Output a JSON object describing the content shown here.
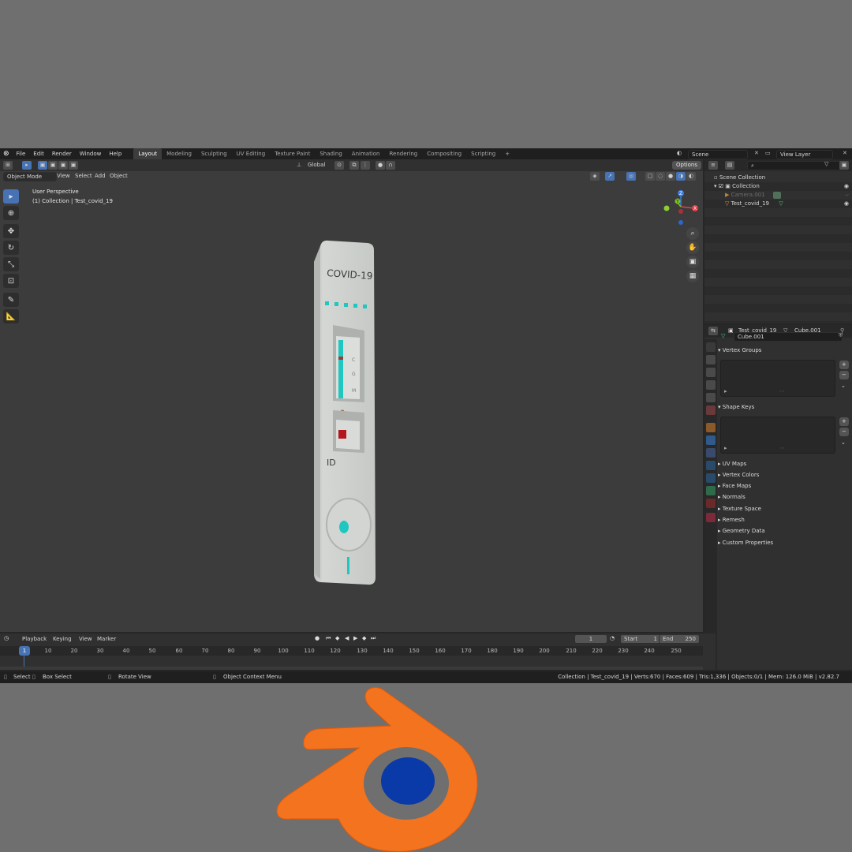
{
  "menubar": {
    "menus": [
      "File",
      "Edit",
      "Render",
      "Window",
      "Help"
    ],
    "workspaces": [
      "Layout",
      "Modeling",
      "Sculpting",
      "UV Editing",
      "Texture Paint",
      "Shading",
      "Animation",
      "Rendering",
      "Compositing",
      "Scripting"
    ],
    "active_workspace": "Layout",
    "add_tab": "+",
    "scene": "Scene",
    "view_layer": "View Layer"
  },
  "viewport": {
    "transform_orientation": "Global",
    "options_label": "Options",
    "mode": "Object Mode",
    "menus": [
      "View",
      "Select",
      "Add",
      "Object"
    ],
    "overlay_title": "User Perspective",
    "overlay_subtitle": "(1) Collection | Test_covid_19",
    "gizmo_axes": {
      "z": "Z",
      "x": "X",
      "y": "Y"
    }
  },
  "model": {
    "title": "COVID-19",
    "window_labels": [
      "C",
      "G",
      "M"
    ],
    "id_label": "ID",
    "accent_color": "#1fc7c0",
    "body_color": "#cfd2cf"
  },
  "outliner": {
    "root": "Scene Collection",
    "collection": "Collection",
    "items": [
      "Camera.001",
      "Test_covid_19"
    ]
  },
  "properties": {
    "object_name": "Test_covid_19",
    "mesh_name": "Cube.001",
    "data_field": "Cube.001",
    "panels_open": [
      "Vertex Groups",
      "Shape Keys"
    ],
    "panels_closed": [
      "UV Maps",
      "Vertex Colors",
      "Face Maps",
      "Normals",
      "Texture Space",
      "Remesh",
      "Geometry Data",
      "Custom Properties"
    ]
  },
  "timeline": {
    "menus": [
      "Playback",
      "Keying",
      "View",
      "Marker"
    ],
    "current_frame": "1",
    "start_label": "Start",
    "start_value": "1",
    "end_label": "End",
    "end_value": "250",
    "ticks": [
      "1",
      "10",
      "20",
      "30",
      "40",
      "50",
      "60",
      "70",
      "80",
      "90",
      "100",
      "110",
      "120",
      "130",
      "140",
      "150",
      "160",
      "170",
      "180",
      "190",
      "200",
      "210",
      "220",
      "230",
      "240",
      "250"
    ]
  },
  "statusbar": {
    "select": "Select",
    "box_select": "Box Select",
    "rotate": "Rotate View",
    "context_menu": "Object Context Menu",
    "stats": "Collection | Test_covid_19 | Verts:670 | Faces:609 | Tris:1,336 | Objects:0/1 | Mem: 126.0 MiB | v2.82.7"
  },
  "colors": {
    "blender_orange": "#f4731f",
    "blender_blue": "#0a3aa8",
    "active_blue": "#4772b3"
  }
}
